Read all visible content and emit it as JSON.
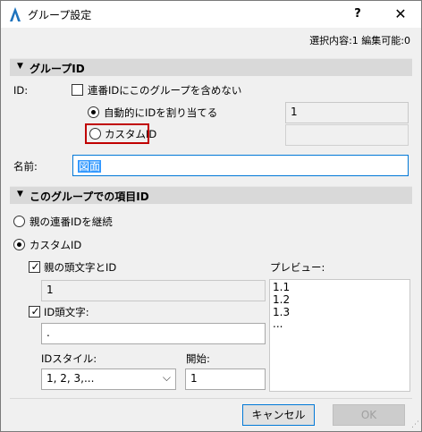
{
  "window": {
    "title": "グループ設定",
    "help_label": "?",
    "close_label": "✕"
  },
  "selection_info": "選択内容:1 編集可能:0",
  "group_id_section": {
    "header": "グループID",
    "id_label": "ID:",
    "exclude_checkbox": {
      "label": "連番IDにこのグループを含めない",
      "checked": false
    },
    "auto_radio": {
      "label": "自動的にIDを割り当てる",
      "selected": true,
      "value": "1"
    },
    "custom_radio": {
      "label": "カスタムID",
      "selected": false,
      "value": ""
    },
    "name_label": "名前:",
    "name_value": "図面"
  },
  "item_id_section": {
    "header": "このグループでの項目ID",
    "inherit_radio": {
      "label": "親の連番IDを継続",
      "selected": false
    },
    "custom_radio": {
      "label": "カスタムID",
      "selected": true
    },
    "parent_prefix_checkbox": {
      "label": "親の頭文字とID",
      "checked": true,
      "value": "1"
    },
    "id_prefix_checkbox": {
      "label": "ID頭文字:",
      "checked": true,
      "value": "."
    },
    "id_style_label": "IDスタイル:",
    "id_style_value": "1, 2, 3,...",
    "start_label": "開始:",
    "start_value": "1",
    "preview_label": "プレビュー:",
    "preview_lines": [
      "1.1",
      "1.2",
      "1.3",
      "..."
    ]
  },
  "footer": {
    "cancel_label": "キャンセル",
    "ok_label": "OK"
  },
  "icons": {
    "app": "archicad-logo-icon",
    "section_toggle": "triangle-down-icon",
    "dropdown": "chevron-down-icon"
  },
  "colors": {
    "highlight": "#c00000",
    "section_bg": "#d9d9d9",
    "selection": "#3399ff",
    "focus": "#0078d7"
  }
}
